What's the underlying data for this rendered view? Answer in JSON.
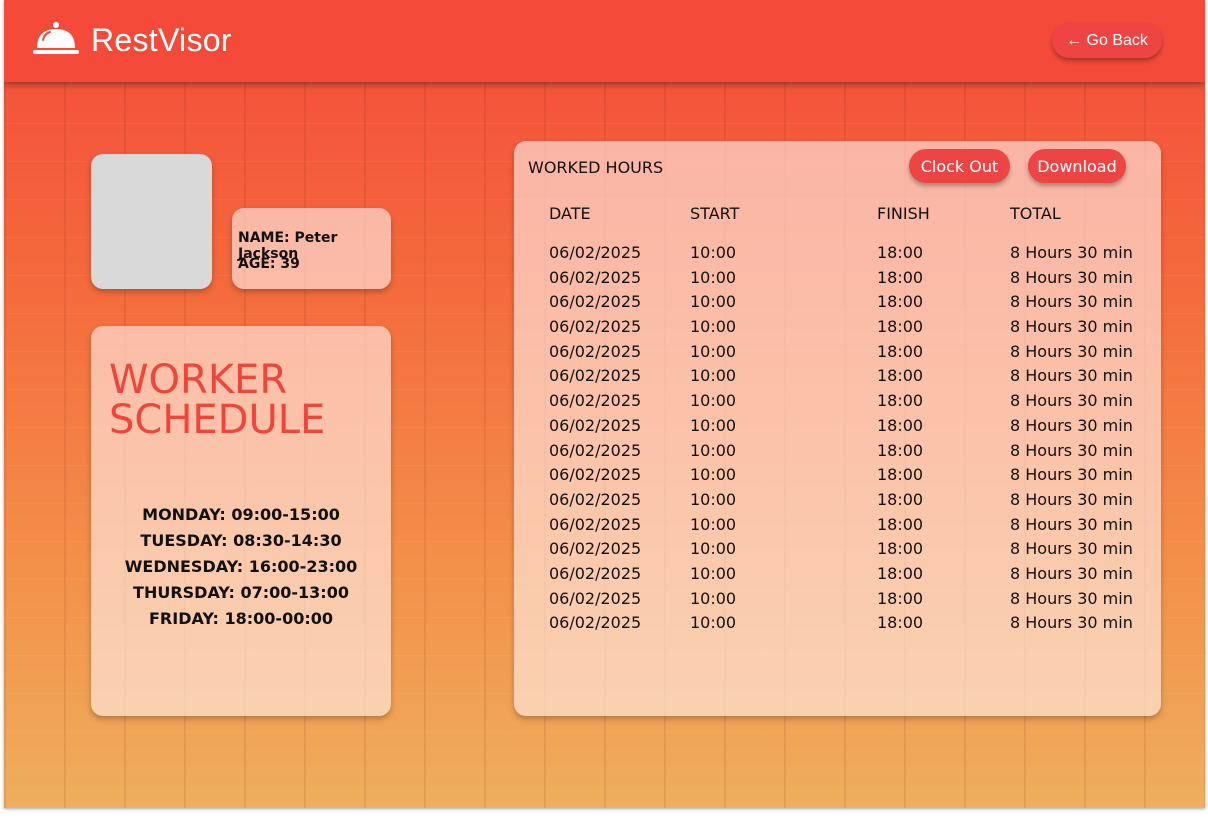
{
  "header": {
    "brand": "RestVisor",
    "logo_icon": "cloche-icon",
    "go_back_label": "← Go Back"
  },
  "profile": {
    "name_line": "NAME: Peter Jackson",
    "age_line": "AGE: 39"
  },
  "schedule": {
    "title_line1": "WORKER",
    "title_line2": "SCHEDULE",
    "items": [
      "MONDAY: 09:00-15:00",
      "TUESDAY: 08:30-14:30",
      "WEDNESDAY: 16:00-23:00",
      "THURSDAY: 07:00-13:00",
      "FRIDAY: 18:00-00:00"
    ]
  },
  "worked_hours": {
    "title": "WORKED HOURS",
    "clock_out_label": "Clock Out",
    "download_label": "Download",
    "columns": [
      "DATE",
      "START",
      "FINISH",
      "TOTAL"
    ],
    "rows": [
      [
        "06/02/2025",
        "10:00",
        "18:00",
        "8 Hours 30 min"
      ],
      [
        "06/02/2025",
        "10:00",
        "18:00",
        "8 Hours 30 min"
      ],
      [
        "06/02/2025",
        "10:00",
        "18:00",
        "8 Hours 30 min"
      ],
      [
        "06/02/2025",
        "10:00",
        "18:00",
        "8 Hours 30 min"
      ],
      [
        "06/02/2025",
        "10:00",
        "18:00",
        "8 Hours 30 min"
      ],
      [
        "06/02/2025",
        "10:00",
        "18:00",
        "8 Hours 30 min"
      ],
      [
        "06/02/2025",
        "10:00",
        "18:00",
        "8 Hours 30 min"
      ],
      [
        "06/02/2025",
        "10:00",
        "18:00",
        "8 Hours 30 min"
      ],
      [
        "06/02/2025",
        "10:00",
        "18:00",
        "8 Hours 30 min"
      ],
      [
        "06/02/2025",
        "10:00",
        "18:00",
        "8 Hours 30 min"
      ],
      [
        "06/02/2025",
        "10:00",
        "18:00",
        "8 Hours 30 min"
      ],
      [
        "06/02/2025",
        "10:00",
        "18:00",
        "8 Hours 30 min"
      ],
      [
        "06/02/2025",
        "10:00",
        "18:00",
        "8 Hours 30 min"
      ],
      [
        "06/02/2025",
        "10:00",
        "18:00",
        "8 Hours 30 min"
      ],
      [
        "06/02/2025",
        "10:00",
        "18:00",
        "8 Hours 30 min"
      ],
      [
        "06/02/2025",
        "10:00",
        "18:00",
        "8 Hours 30 min"
      ]
    ]
  },
  "colors": {
    "header": "#f44a3a",
    "button": "#ef4444",
    "accent_title": "#f0453a"
  }
}
